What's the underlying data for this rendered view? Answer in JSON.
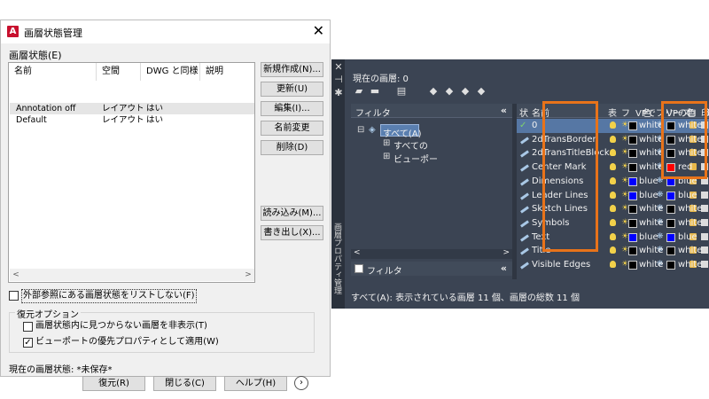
{
  "dialog": {
    "title": "画層状態管理",
    "close_glyph": "✕",
    "section_label": "画層状態(E)",
    "columns": [
      "名前",
      "空間",
      "DWG と同様",
      "説明"
    ],
    "rows": [
      {
        "name": "Annotation off",
        "space": "レイアウト",
        "same": "はい",
        "desc": ""
      },
      {
        "name": "Default",
        "space": "レイアウト",
        "same": "はい",
        "desc": ""
      }
    ],
    "buttons": {
      "new": "新規作成(N)...",
      "update": "更新(U)",
      "edit": "編集(I)...",
      "rename": "名前変更",
      "delete": "削除(D)",
      "import": "読み込み(M)...",
      "export": "書き出し(X)..."
    },
    "xref_checkbox": {
      "label": "外部参照にある画層状態をリストしない(F)",
      "checked": false
    },
    "restore_group": {
      "legend": "復元オプション",
      "options": [
        {
          "label": "画層状態内に見つからない画層を非表示(T)",
          "checked": false
        },
        {
          "label": "ビューポートの優先プロパティとして適用(W)",
          "checked": true
        }
      ]
    },
    "current_state": "現在の画層状態: *未保存*",
    "bottom_buttons": {
      "restore": "復元(R)",
      "close": "閉じる(C)",
      "help": "ヘルプ(H)"
    },
    "next_glyph": "›"
  },
  "palette": {
    "strip_title": "画層プロパティ管理",
    "current_layer": "現在の画層: 0",
    "filter_header": "フィルタ",
    "collapse_glyph": "«",
    "tree": [
      {
        "label": "すべて(A)",
        "selected": true
      },
      {
        "label": "すべての"
      },
      {
        "label": "ビューポー"
      }
    ],
    "filter_footer": "フィルタ",
    "columns": {
      "status": "状",
      "name": "名前",
      "on": "表",
      "freeze": "フ",
      "vp_freeze": "VPでフリーズ",
      "lock": "ロ",
      "plot": "印",
      "color": "色",
      "vp_color": "VPの色",
      "extra": "線"
    },
    "layers": [
      {
        "name": "0",
        "color": "white",
        "vp_color": "white",
        "current": true
      },
      {
        "name": "2dTransBorder",
        "color": "white",
        "vp_color": "white"
      },
      {
        "name": "2dTransTitleBlock",
        "color": "white",
        "vp_color": "white"
      },
      {
        "name": "Center Mark",
        "color": "white",
        "vp_color": "red"
      },
      {
        "name": "Dimensions",
        "color": "blue",
        "vp_color": "blue"
      },
      {
        "name": "Leader Lines",
        "color": "blue",
        "vp_color": "blue"
      },
      {
        "name": "Sketch Lines",
        "color": "white",
        "vp_color": "white"
      },
      {
        "name": "Symbols",
        "color": "white",
        "vp_color": "white"
      },
      {
        "name": "Text",
        "color": "blue",
        "vp_color": "blue"
      },
      {
        "name": "Title",
        "color": "white",
        "vp_color": "white"
      },
      {
        "name": "Visible Edges",
        "color": "white",
        "vp_color": "white"
      }
    ],
    "color_map": {
      "white": "#000000",
      "blue": "#0000ff",
      "red": "#ff0000"
    },
    "highlight_color": "#e8731a",
    "status_text": "すべて(A): 表示されている画層 11 個、画層の総数 11 個"
  }
}
